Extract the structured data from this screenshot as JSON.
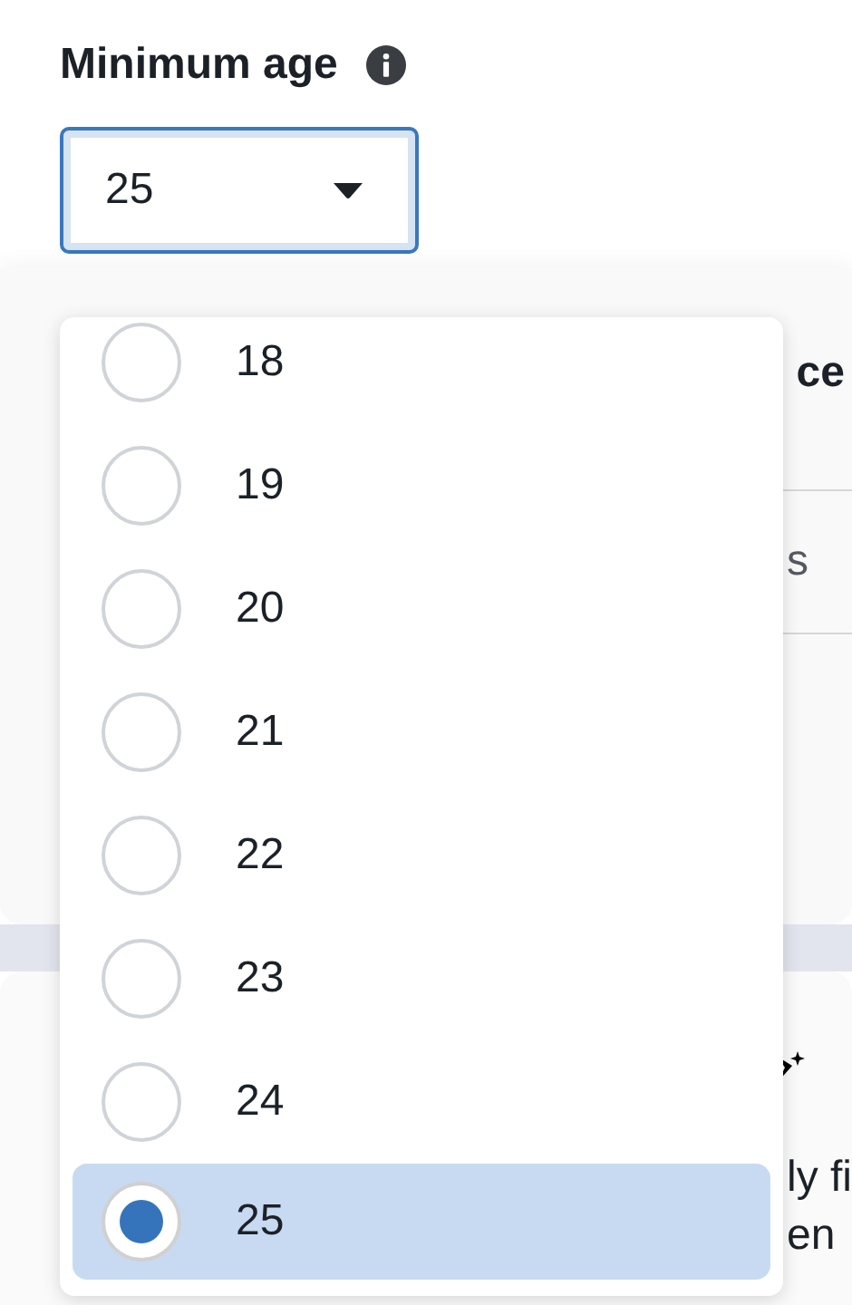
{
  "title": "Minimum age",
  "select": {
    "value": "25",
    "expanded": true
  },
  "options": [
    {
      "label": "18",
      "selected": false
    },
    {
      "label": "19",
      "selected": false
    },
    {
      "label": "20",
      "selected": false
    },
    {
      "label": "21",
      "selected": false
    },
    {
      "label": "22",
      "selected": false
    },
    {
      "label": "23",
      "selected": false
    },
    {
      "label": "24",
      "selected": false
    },
    {
      "label": "25",
      "selected": true
    }
  ],
  "background": {
    "heading": "ce",
    "tab_label": "s",
    "text_lines": [
      "ly fi",
      "en"
    ]
  }
}
